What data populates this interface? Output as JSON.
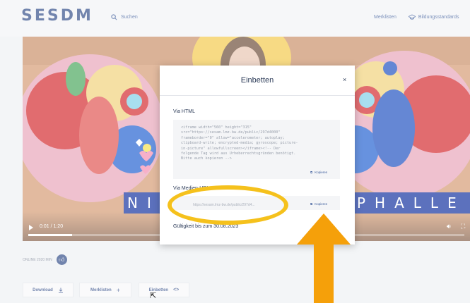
{
  "header": {
    "logo": "SESDM",
    "search_label": "Suchen",
    "nav": [
      {
        "label": "Merklisten",
        "icon": "none"
      },
      {
        "label": "Bildungsstandards",
        "icon": "graduation-cap-icon"
      }
    ]
  },
  "video": {
    "title_left": "NI",
    "title_right": "PHALLE",
    "time": "0:01 / 1:20",
    "progress": 0.1
  },
  "meta": {
    "text": "ONLINE   2020   MIN"
  },
  "actions": {
    "download_label": "Download",
    "merklisten_label": "Merklisten",
    "embed_label": "Einbetten"
  },
  "modal": {
    "title": "Einbetten",
    "close": "×",
    "html_label": "Via HTML",
    "html_code": "<iframe width=\"560\" height=\"315\"\nsrc=\"https://sesam.lmz-bw.de/public/297d4000\"\nframeborder=\"0\" allow=\"accelerometer; autoplay;\nclipboard-write; encrypted-media; gyroscope; picture-\nin-picture\" allowfullscreen></iframe><!-- Der\nfolgende Tag wird aus Urheberrechtsgründen benötigt.\nBitte auch kopieren -->",
    "copy_label": "Kopieren",
    "url_label": "Via Medien-URL",
    "url_value": "https://sesam.lmz-bw.de/public/297d4...",
    "valid_until": "Gültigkeit bis zum 30.08.2023"
  },
  "colors": {
    "brand": "#2f4a86",
    "highlight": "#f5c11c",
    "arrow": "#f5a00a"
  }
}
